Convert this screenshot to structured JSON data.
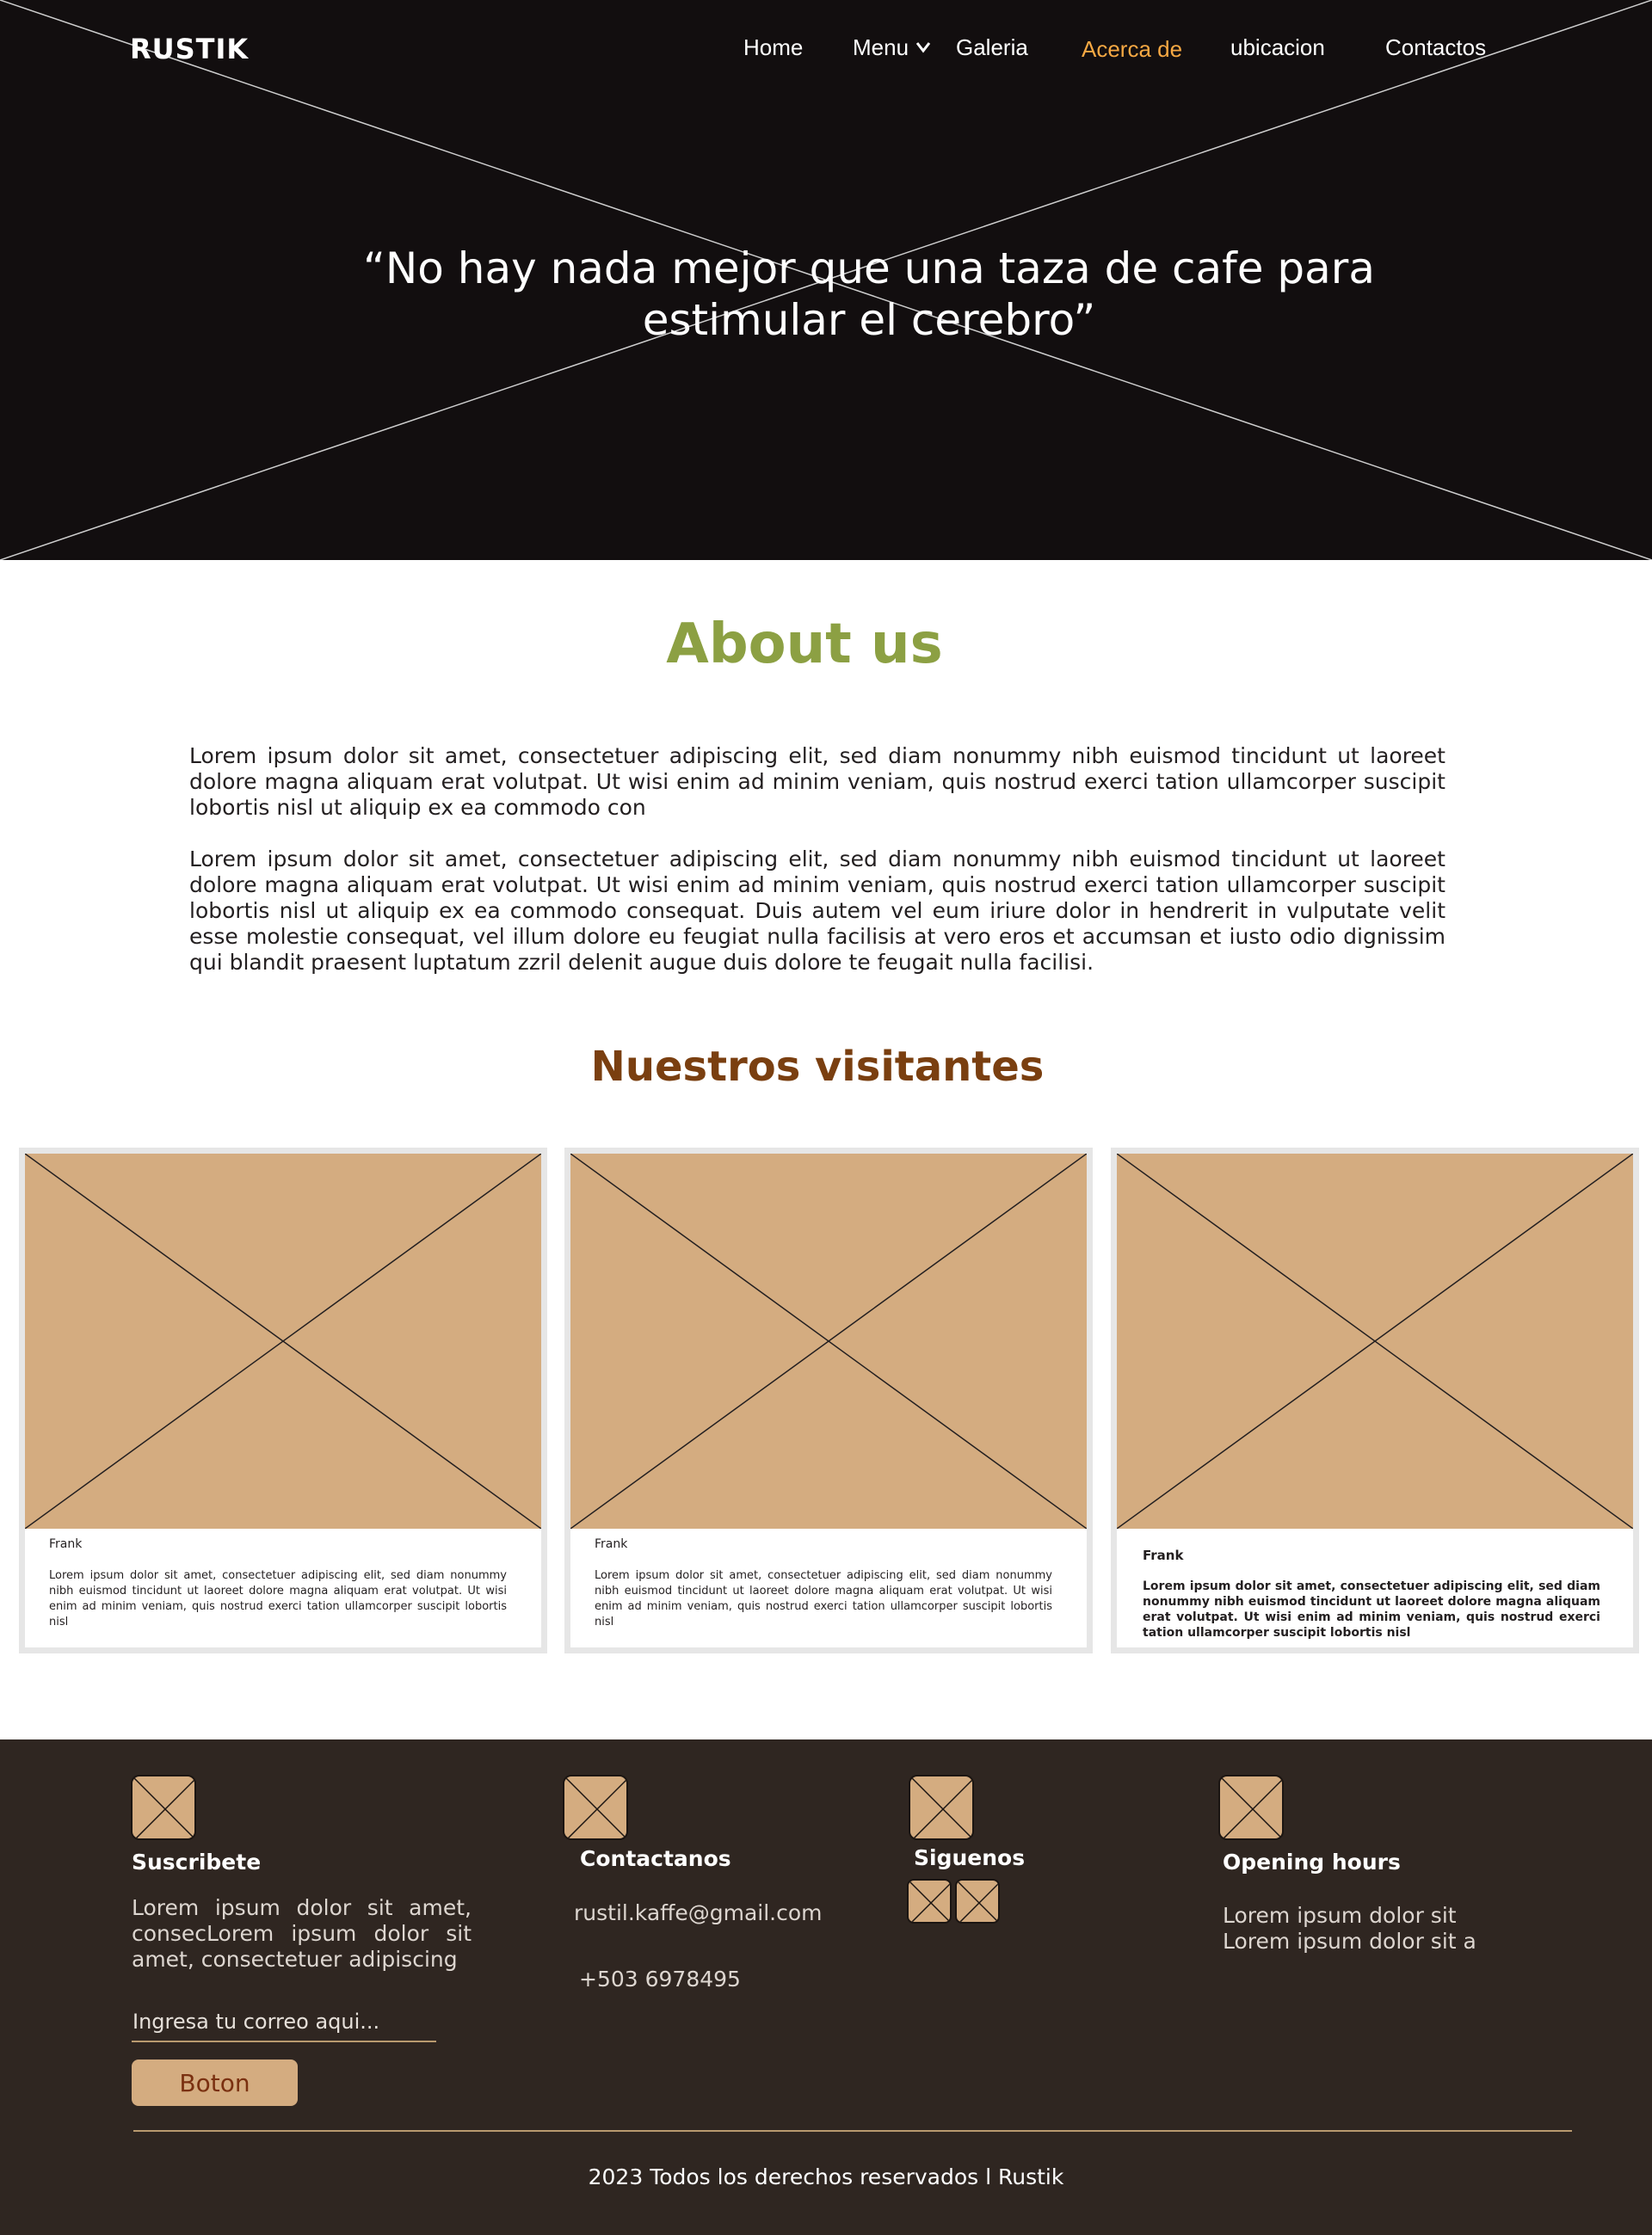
{
  "header": {
    "logo": "RUSTIK",
    "nav": {
      "home": "Home",
      "menu": "Menu",
      "galeria": "Galeria",
      "acerca": "Acerca de",
      "ubicacion": "ubicacion",
      "contactos": "Contactos"
    },
    "active_color": "#f6a843"
  },
  "hero": {
    "quote_line1": "“No hay nada mejor que una taza de cafe para",
    "quote_line2": "estimular el cerebro”",
    "background": "#120e0f"
  },
  "about": {
    "title": "About us",
    "title_color": "#8ca043",
    "paragraph1": "Lorem ipsum dolor sit amet, consectetuer adipiscing elit, sed diam nonummy nibh euismod tincidunt ut laoreet dolore magna aliquam erat volutpat. Ut wisi enim ad minim veniam, quis nostrud exerci tation ullamcorper suscipit lobortis nisl ut aliquip ex ea commodo con",
    "paragraph2": "Lorem ipsum dolor sit amet, consectetuer adipiscing elit, sed diam nonummy nibh euismod tincidunt ut laoreet dolore magna aliquam erat volutpat. Ut wisi enim ad minim veniam, quis nostrud exerci tation ullamcorper suscipit lobortis nisl ut aliquip ex ea commodo consequat. Duis autem vel eum iriure dolor in hendrerit in vulputate velit esse molestie consequat, vel illum dolore eu feugiat nulla facilisis at vero eros et accumsan et iusto odio dignissim qui blandit praesent luptatum zzril delenit augue duis dolore te feugait nulla facilisi."
  },
  "visitors": {
    "title": "Nuestros visitantes",
    "title_color": "#7a3f10",
    "cards": [
      {
        "name": "Frank",
        "text": "Lorem ipsum dolor sit amet, consectetuer adipiscing elit, sed diam nonummy nibh euismod tincidunt ut laoreet dolore magna aliquam erat volutpat. Ut wisi enim ad minim veniam, quis nostrud exerci tation ullamcorper suscipit lobortis nisl"
      },
      {
        "name": "Frank",
        "text": "Lorem ipsum dolor sit amet, consectetuer adipiscing elit, sed diam nonummy nibh euismod tincidunt ut laoreet dolore magna aliquam erat volutpat. Ut wisi enim ad minim veniam, quis nostrud exerci tation ullamcorper suscipit lobortis nisl"
      },
      {
        "name": "Frank",
        "text": "Lorem ipsum dolor sit amet, consectetuer adipiscing elit, sed diam nonummy nibh euismod tincidunt ut laoreet dolore magna aliquam erat volutpat. Ut wisi enim ad minim veniam, quis nostrud exerci tation ullamcorper suscipit lobortis nisl"
      }
    ],
    "placeholder_color": "#d4ac80"
  },
  "footer": {
    "background": "#2f2621",
    "subscribe": {
      "title": "Suscribete",
      "text": "Lorem ipsum dolor sit amet, consecLorem ipsum dolor sit amet, consectetuer adipiscing",
      "input_placeholder": "Ingresa tu correo aqui...",
      "button": "Boton"
    },
    "contact": {
      "title": "Contactanos",
      "email": "rustil.kaffe@gmail.com",
      "phone": "+503 6978495"
    },
    "follow": {
      "title": "Siguenos"
    },
    "hours": {
      "title": "Opening hours",
      "line1": "Lorem ipsum dolor sit",
      "line2": "Lorem ipsum dolor sit a"
    },
    "copyright": "2023 Todos los derechos reservados l Rustik"
  }
}
